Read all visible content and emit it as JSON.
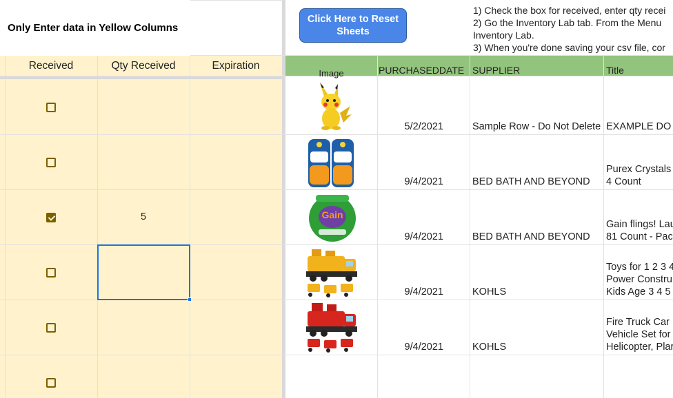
{
  "header": {
    "title": "Only Enter data in Yellow Columns",
    "reset_button": "Click Here to Reset Sheets",
    "instructions": [
      "1) Check the box for received, enter qty recei",
      "2) Go the Inventory Lab tab.  From the Menu",
      "Inventory Lab.",
      "3) When you're done saving your csv file, cor"
    ]
  },
  "columns": {
    "received": "Received",
    "qty_received": "Qty Received",
    "expiration": "Expiration",
    "image": "Image",
    "purchase_date": "PURCHASEDDATE",
    "supplier": "SUPPLIER",
    "title": "Title"
  },
  "colors": {
    "yellow_fill": "#fff2cc",
    "green_header": "#93c47d",
    "button_blue": "#4a86e8",
    "selection_blue": "#1a73e8"
  },
  "rows": [
    {
      "received": false,
      "qty": "",
      "image": "pikachu-plush-image",
      "date": "5/2/2021",
      "supplier": "Sample Row - Do Not Delete",
      "title_lines": [
        "EXAMPLE DO"
      ]
    },
    {
      "received": false,
      "qty": "",
      "image": "purex-crystals-image",
      "date": "9/4/2021",
      "supplier": "BED BATH AND BEYOND",
      "title_lines": [
        "Purex Crystals",
        "4 Count"
      ]
    },
    {
      "received": true,
      "qty": "5",
      "image": "gain-flings-image",
      "date": "9/4/2021",
      "supplier": "BED BATH AND BEYOND",
      "title_lines": [
        "Gain flings! Lau",
        "81 Count - Pac"
      ]
    },
    {
      "received": false,
      "qty": "",
      "image": "construction-truck-toy-image",
      "date": "9/4/2021",
      "supplier": "KOHLS",
      "title_lines": [
        "Toys for 1 2 3 4",
        "Power Constru",
        "Kids Age 3 4 5"
      ]
    },
    {
      "received": false,
      "qty": "",
      "image": "fire-truck-toy-image",
      "date": "9/4/2021",
      "supplier": "KOHLS",
      "title_lines": [
        "Fire Truck Car",
        "Vehicle Set for",
        "Helicopter, Plar"
      ]
    },
    {
      "received": false,
      "qty": "",
      "image": "",
      "date": "",
      "supplier": "",
      "title_lines": []
    }
  ]
}
